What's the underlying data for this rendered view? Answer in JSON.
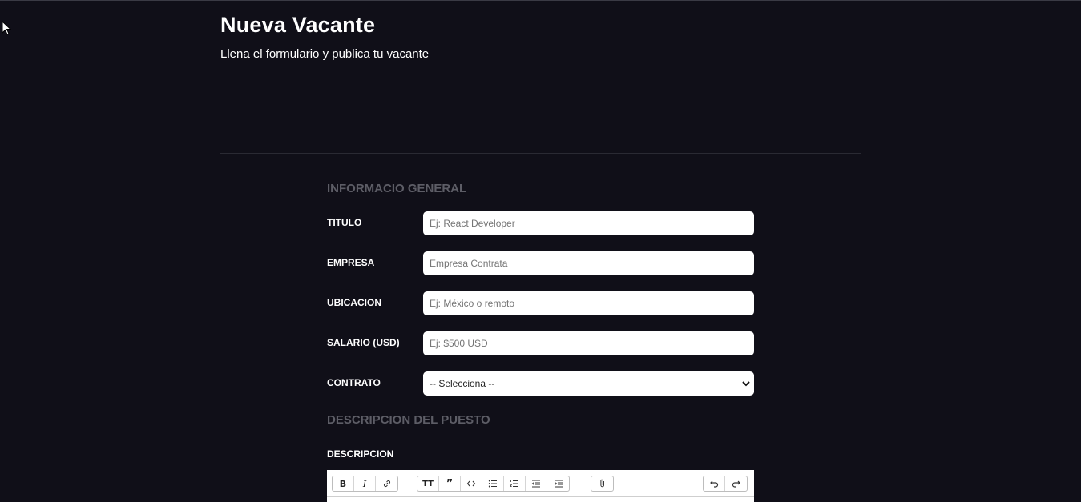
{
  "header": {
    "title": "Nueva Vacante",
    "subtitle": "Llena el formulario y publica tu vacante"
  },
  "sections": {
    "general": "INFORMACIO GENERAL",
    "description": "DESCRIPCION DEL PUESTO"
  },
  "form": {
    "titulo": {
      "label": "TITULO",
      "placeholder": "Ej: React Developer",
      "value": ""
    },
    "empresa": {
      "label": "EMPRESA",
      "placeholder": "Empresa Contrata",
      "value": ""
    },
    "ubicacion": {
      "label": "UBICACION",
      "placeholder": "Ej: México o remoto",
      "value": ""
    },
    "salario": {
      "label": "SALARIO (USD)",
      "placeholder": "Ej: $500 USD",
      "value": ""
    },
    "contrato": {
      "label": "CONTRATO",
      "selected": "-- Selecciona --"
    }
  },
  "editor": {
    "label": "DESCRIPCION",
    "toolbar": [
      "bold-icon",
      "italic-icon",
      "link-icon",
      "heading-icon",
      "quote-icon",
      "code-icon",
      "bullet-list-icon",
      "numbered-list-icon",
      "decrease-indent-icon",
      "increase-indent-icon",
      "attach-icon",
      "undo-icon",
      "redo-icon"
    ]
  }
}
